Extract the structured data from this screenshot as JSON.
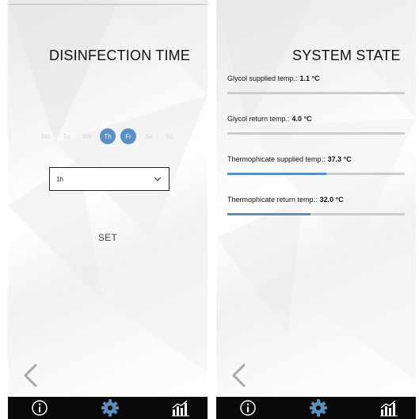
{
  "left_screen": {
    "title": "DISINFECTION TIME",
    "days": [
      {
        "label": "Mo",
        "active": false
      },
      {
        "label": "Tu",
        "active": false
      },
      {
        "label": "We",
        "active": false
      },
      {
        "label": "Th",
        "active": true
      },
      {
        "label": "Fr",
        "active": true
      },
      {
        "label": "Sa",
        "active": false
      },
      {
        "label": "Su",
        "active": false
      }
    ],
    "time_select": {
      "value": "1h"
    },
    "set_label": "SET"
  },
  "right_screen": {
    "title": "SYSTEM STATE",
    "items": [
      {
        "label": "Glycol supplied temp.:",
        "value": "1.1 °C",
        "fill_fraction": 0.0
      },
      {
        "label": "Glycol return temp.:",
        "value": "4.0 °C",
        "fill_fraction": 0.0
      },
      {
        "label": "Thermophicate supplied temp.:",
        "value": "37.3 °C",
        "fill_fraction": 0.56
      },
      {
        "label": "Thermophicate return temp.:",
        "value": "32.0 °C",
        "fill_fraction": 0.47
      }
    ]
  },
  "navigation": {
    "back_icon": "chevron-left-icon",
    "items": [
      "info-icon",
      "gear-icon",
      "chart-icon"
    ]
  },
  "colors": {
    "accent": "#5b8ec1",
    "nav_bar": "#0a0a0a",
    "track": "#c8cdd3"
  }
}
